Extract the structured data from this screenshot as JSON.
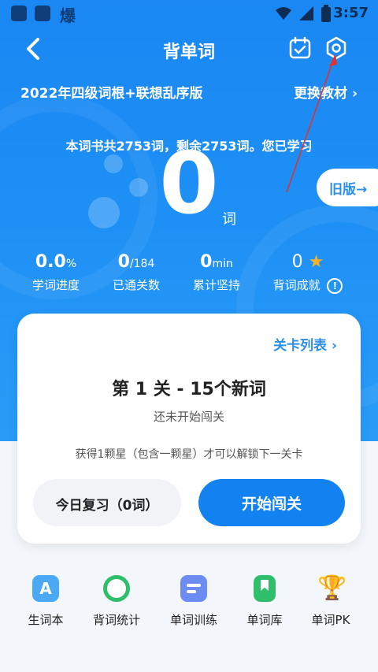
{
  "statusbar": {
    "glyph": "爆",
    "time": "3:57"
  },
  "header": {
    "title": "背单词"
  },
  "book": {
    "name": "2022年四级词根+联想乱序版",
    "change_label": "更换教材"
  },
  "summary": {
    "text": "本词书共2753词，剩余2753词。您已学习",
    "count": "0",
    "unit": "词"
  },
  "old_version": "旧版→",
  "stats": [
    {
      "value": "0.0",
      "suffix": "%",
      "label": "学词进度"
    },
    {
      "value": "0",
      "suffix": "/184",
      "label": "已通关数"
    },
    {
      "value": "0",
      "suffix": "min",
      "label": "累计坚持"
    },
    {
      "value": "0",
      "suffix": "★",
      "label": "背词成就"
    }
  ],
  "card": {
    "level_list": "关卡列表",
    "level_title": "第 1 关 - 15个新词",
    "level_status": "还未开始闯关",
    "unlock_hint": "获得1颗星（包含一颗星）才可以解锁下一关卡",
    "review_button": "今日复习（0词）",
    "start_button": "开始闯关"
  },
  "nav": [
    {
      "label": "生词本",
      "icon": "letter-a-icon",
      "color": "#4aa8f5"
    },
    {
      "label": "背词统计",
      "icon": "pie-chart-icon",
      "color": "#2fbf6a"
    },
    {
      "label": "单词训练",
      "icon": "training-icon",
      "color": "#6c8cf2"
    },
    {
      "label": "单词库",
      "icon": "bookmark-icon",
      "color": "#2fbf6a"
    },
    {
      "label": "单词PK",
      "icon": "trophy-icon",
      "color": "#f4b223"
    }
  ],
  "colors": {
    "primary": "#1282f0",
    "hero": "#1d8ff5",
    "accent_star": "#f7b32b"
  }
}
